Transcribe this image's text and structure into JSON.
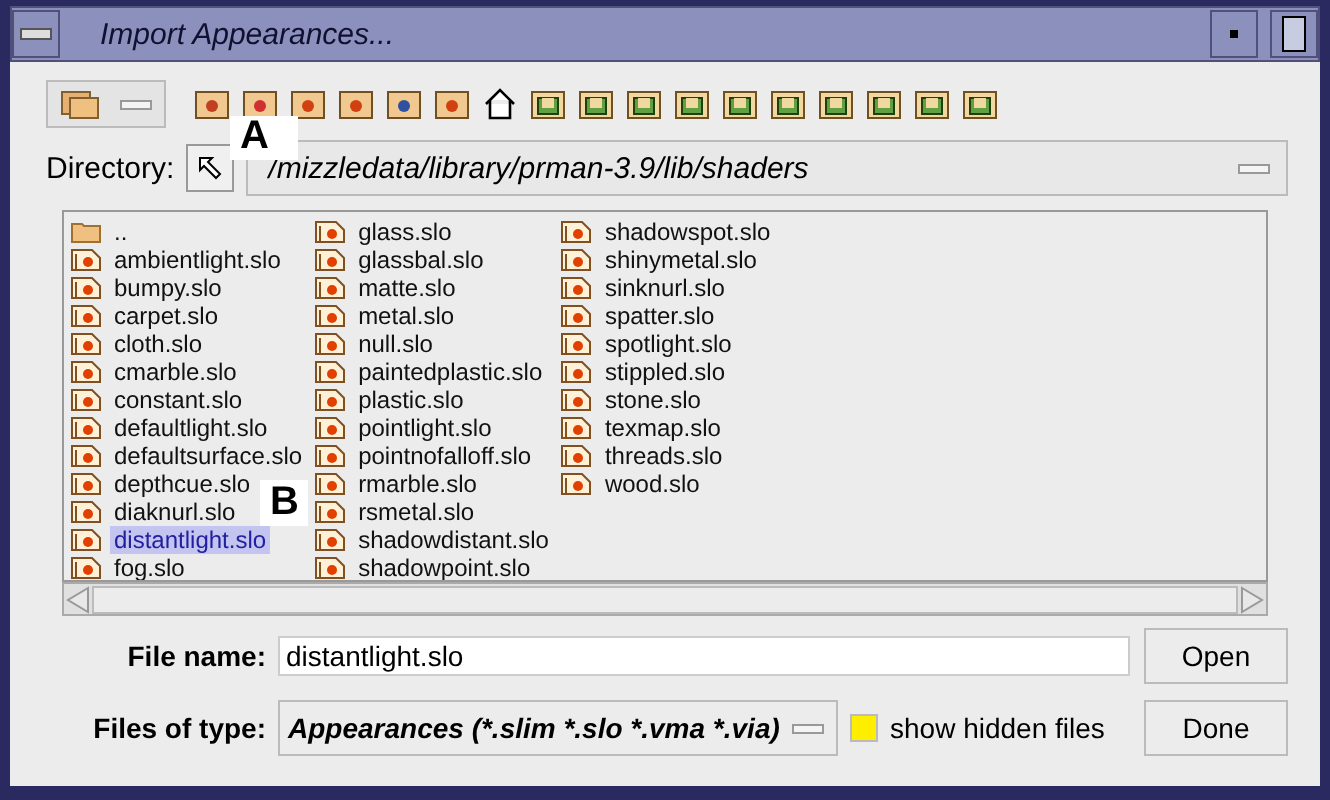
{
  "window": {
    "title": "Import Appearances..."
  },
  "directory": {
    "label": "Directory:",
    "path": "/mizzledata/library/prman-3.9/lib/shaders"
  },
  "files": [
    {
      "name": "..",
      "kind": "folder",
      "selected": false
    },
    {
      "name": "ambientlight.slo",
      "kind": "file",
      "selected": false
    },
    {
      "name": "bumpy.slo",
      "kind": "file",
      "selected": false
    },
    {
      "name": "carpet.slo",
      "kind": "file",
      "selected": false
    },
    {
      "name": "cloth.slo",
      "kind": "file",
      "selected": false
    },
    {
      "name": "cmarble.slo",
      "kind": "file",
      "selected": false
    },
    {
      "name": "constant.slo",
      "kind": "file",
      "selected": false
    },
    {
      "name": "defaultlight.slo",
      "kind": "file",
      "selected": false
    },
    {
      "name": "defaultsurface.slo",
      "kind": "file",
      "selected": false
    },
    {
      "name": "depthcue.slo",
      "kind": "file",
      "selected": false
    },
    {
      "name": "diaknurl.slo",
      "kind": "file",
      "selected": false
    },
    {
      "name": "distantlight.slo",
      "kind": "file",
      "selected": true
    },
    {
      "name": "fog.slo",
      "kind": "file",
      "selected": false
    },
    {
      "name": "glass.slo",
      "kind": "file",
      "selected": false
    },
    {
      "name": "glassbal.slo",
      "kind": "file",
      "selected": false
    },
    {
      "name": "matte.slo",
      "kind": "file",
      "selected": false
    },
    {
      "name": "metal.slo",
      "kind": "file",
      "selected": false
    },
    {
      "name": "null.slo",
      "kind": "file",
      "selected": false
    },
    {
      "name": "paintedplastic.slo",
      "kind": "file",
      "selected": false
    },
    {
      "name": "plastic.slo",
      "kind": "file",
      "selected": false
    },
    {
      "name": "pointlight.slo",
      "kind": "file",
      "selected": false
    },
    {
      "name": "pointnofalloff.slo",
      "kind": "file",
      "selected": false
    },
    {
      "name": "rmarble.slo",
      "kind": "file",
      "selected": false
    },
    {
      "name": "rsmetal.slo",
      "kind": "file",
      "selected": false
    },
    {
      "name": "shadowdistant.slo",
      "kind": "file",
      "selected": false
    },
    {
      "name": "shadowpoint.slo",
      "kind": "file",
      "selected": false
    },
    {
      "name": "shadowspot.slo",
      "kind": "file",
      "selected": false
    },
    {
      "name": "shinymetal.slo",
      "kind": "file",
      "selected": false
    },
    {
      "name": "sinknurl.slo",
      "kind": "file",
      "selected": false
    },
    {
      "name": "spatter.slo",
      "kind": "file",
      "selected": false
    },
    {
      "name": "spotlight.slo",
      "kind": "file",
      "selected": false
    },
    {
      "name": "stippled.slo",
      "kind": "file",
      "selected": false
    },
    {
      "name": "stone.slo",
      "kind": "file",
      "selected": false
    },
    {
      "name": "texmap.slo",
      "kind": "file",
      "selected": false
    },
    {
      "name": "threads.slo",
      "kind": "file",
      "selected": false
    },
    {
      "name": "wood.slo",
      "kind": "file",
      "selected": false
    }
  ],
  "file_name": {
    "label": "File name:",
    "value": "distantlight.slo"
  },
  "files_of_type": {
    "label": "Files of type:",
    "value": "Appearances (*.slim *.slo *.vma *.via)"
  },
  "show_hidden": {
    "label": "show hidden files",
    "checked": true
  },
  "buttons": [
    "Open",
    "Done"
  ],
  "callouts": [
    {
      "label": "A"
    },
    {
      "label": "B"
    }
  ]
}
